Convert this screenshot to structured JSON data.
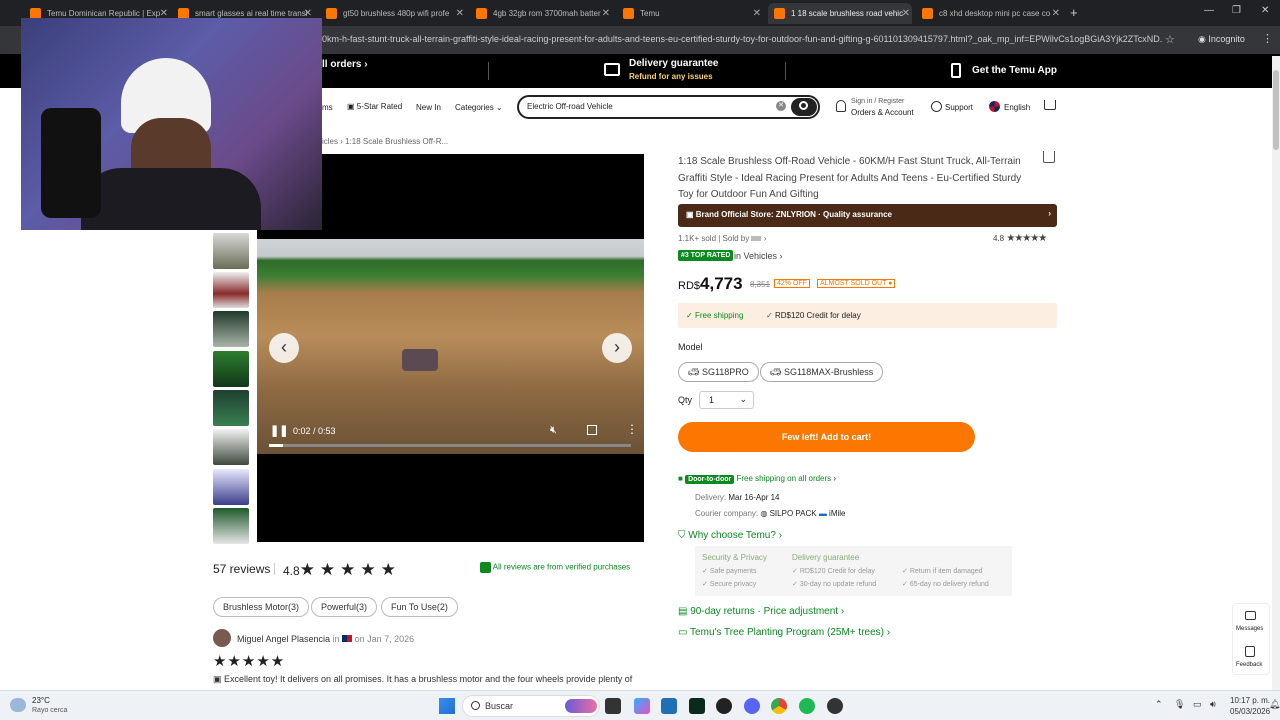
{
  "browser": {
    "tabs": [
      {
        "label": "Temu Dominican Republic | Exp",
        "active": false
      },
      {
        "label": "smart glasses ai real time transl",
        "active": false
      },
      {
        "label": "gt50 brushless 480p wifi profe",
        "active": false
      },
      {
        "label": "4gb 32gb rom 3700mah batter",
        "active": false
      },
      {
        "label": "Temu",
        "active": false
      },
      {
        "label": "1 18 scale brushless road vehic",
        "active": true
      },
      {
        "label": "c8 xhd desktop mini pc case co",
        "active": false
      }
    ],
    "url": "0km-h-fast-stunt-truck-all-terrain-graffiti-style-ideal-racing-present-for-adults-and-teens-eu-certified-sturdy-toy-for-outdoor-fun-and-gifting-g-601101309415797.html?_oak_mp_inf=EPWilvCs1ogBGiA3Yjk2ZTcxND...",
    "incognito": "Incognito"
  },
  "banner": {
    "all_orders": "ll orders",
    "delivery_title": "Delivery guarantee",
    "delivery_sub": "Refund for any issues",
    "app": "Get the Temu App"
  },
  "header": {
    "nav": [
      "ms",
      "5-Star Rated",
      "New In",
      "Categories"
    ],
    "search_value": "Electric Off-road Vehicle",
    "sign_in": "Sign in / Register",
    "orders": "Orders & Account",
    "support": "Support",
    "language": "English"
  },
  "breadcrumb": {
    "parent": "icles",
    "current": "1:18 Scale Brushless Off-R..."
  },
  "video": {
    "time": "0:02 / 0:53",
    "progress": 0.04
  },
  "product": {
    "title": "1:18 Scale Brushless Off-Road Vehicle - 60KM/H Fast Stunt Truck, All-Terrain Graffiti Style - Ideal Racing Present for Adults And Teens - Eu-Certified Sturdy Toy for Outdoor Fun And Gifting",
    "store": "Brand Official Store: ZNLYRION · Quality assurance",
    "sold": "1.1K+ sold | Sold by",
    "rating": "4.8",
    "top_rated_badge": "#3 TOP RATED",
    "top_rated_cat": "in Vehicles",
    "currency": "RD$",
    "price": "4,773",
    "old_price": "8,351",
    "discount": "42% OFF",
    "almost": "ALMOST SOLD OUT",
    "free_shipping": "Free shipping",
    "credit": "RD$120 Credit for delay",
    "model_label": "Model",
    "models": [
      "SG118PRO",
      "SG118MAX-Brushless"
    ],
    "qty_label": "Qty",
    "qty_value": "1",
    "add_to_cart": "Few left! Add to cart!",
    "door_badge": "Door-to-door",
    "door_text": "Free shipping on all orders",
    "delivery_label": "Delivery:",
    "delivery_dates": "Mar 16-Apr 14",
    "courier_label": "Courier company:",
    "courier1": "SILPO PACK",
    "courier2": "iMile",
    "why": "Why choose Temu?",
    "security_title": "Security & Privacy",
    "security_items": [
      "Safe payments",
      "Secure privacy"
    ],
    "guarantee_title": "Delivery guarantee",
    "guarantee_items": [
      "RD$120 Credit for delay",
      "Return if item damaged",
      "30-day no update refund",
      "65-day no delivery refund"
    ],
    "returns": "90-day returns · Price adjustment",
    "tree": "Temu's Tree Planting Program (25M+ trees)"
  },
  "reviews": {
    "count": "57 reviews",
    "rating": "4.8",
    "verified": "All reviews are from verified purchases",
    "tags": [
      "Brushless Motor(3)",
      "Powerful(3)",
      "Fun To Use(2)"
    ],
    "reviewer": "Miguel Angel Plasencia",
    "in": "in",
    "date": "on Jan 7, 2026",
    "text": "Excellent toy! It delivers on all promises. It has a brushless motor and the four wheels provide plenty of"
  },
  "side": {
    "messages": "Messages",
    "feedback": "Feedback"
  },
  "taskbar": {
    "temp": "23°C",
    "weather": "Rayo cerca",
    "search": "Buscar",
    "time": "10:17 p. m.",
    "date": "05/03/2026"
  },
  "colors": {
    "brand": "#fb7701",
    "store_bar": "#4a2a17",
    "verified": "#0a8a1f"
  }
}
